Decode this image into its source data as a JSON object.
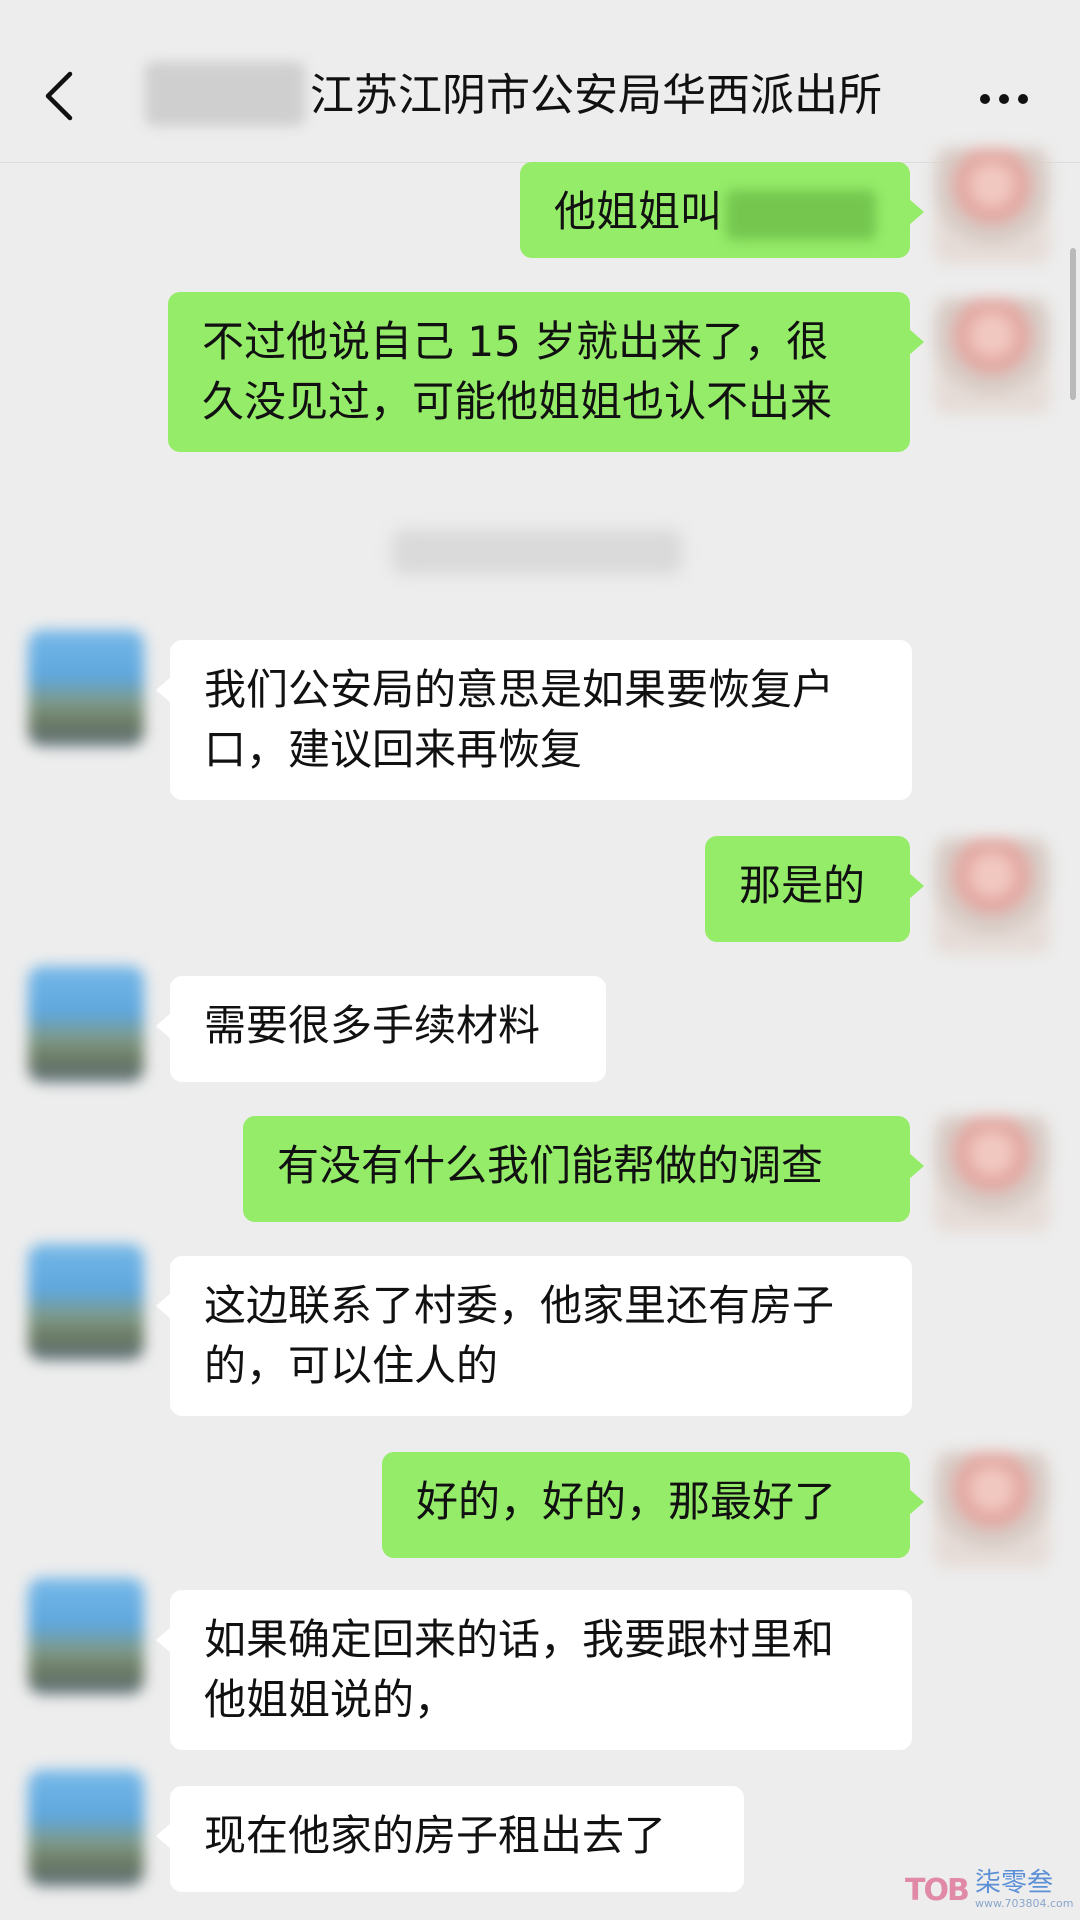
{
  "header": {
    "title": "江苏江阴市公安局华西派出所"
  },
  "icons": {
    "back": "chevron-left-icon",
    "more": "more-dots-icon"
  },
  "colors": {
    "background": "#ededed",
    "sent_bubble": "#95ec69",
    "received_bubble": "#ffffff"
  },
  "messages": [
    {
      "from": "me",
      "lines": [
        "他姐姐叫"
      ]
    },
    {
      "from": "me",
      "lines": [
        "不过他说自己 15 岁就出来了，很",
        "久没见过，可能他姐姐也认不出来"
      ]
    },
    {
      "from": "them",
      "lines": [
        "我们公安局的意思是如果要恢复户",
        "口，建议回来再恢复"
      ]
    },
    {
      "from": "me",
      "lines": [
        "那是的"
      ]
    },
    {
      "from": "them",
      "lines": [
        "需要很多手续材料"
      ]
    },
    {
      "from": "me",
      "lines": [
        "有没有什么我们能帮做的调查"
      ]
    },
    {
      "from": "them",
      "lines": [
        "这边联系了村委，他家里还有房子",
        "的，可以住人的"
      ]
    },
    {
      "from": "me",
      "lines": [
        "好的，好的，那最好了"
      ]
    },
    {
      "from": "them",
      "lines": [
        "如果确定回来的话，我要跟村里和",
        "他姐姐说的，"
      ]
    },
    {
      "from": "them",
      "lines": [
        "现在他家的房子租出去了"
      ]
    }
  ],
  "watermark": {
    "logo": "TOB",
    "text": "柒零叁",
    "url": "www.703804.com"
  }
}
